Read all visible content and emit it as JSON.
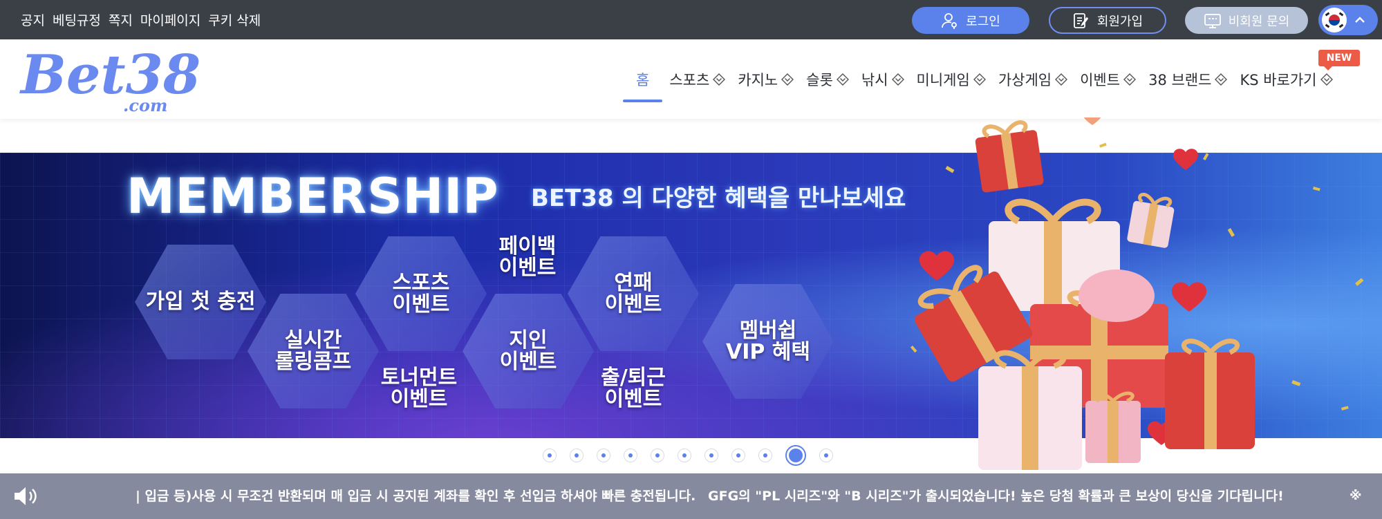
{
  "topbar": {
    "links": [
      "공지",
      "베팅규정",
      "쪽지",
      "마이페이지",
      "쿠키 삭제"
    ],
    "login_label": "로그인",
    "join_label": "회원가입",
    "inquiry_label": "비회원 문의",
    "language_flag": "korea-flag-icon"
  },
  "header": {
    "logo_text": "Bet38",
    "logo_sub": ".com",
    "nav": [
      {
        "label": "홈",
        "active": true
      },
      {
        "label": "스포츠"
      },
      {
        "label": "카지노"
      },
      {
        "label": "슬롯"
      },
      {
        "label": "낚시"
      },
      {
        "label": "미니게임"
      },
      {
        "label": "가상게임"
      },
      {
        "label": "이벤트"
      },
      {
        "label": "38 브랜드"
      },
      {
        "label": "KS 바로가기"
      }
    ],
    "new_badge": "NEW"
  },
  "banner": {
    "title": "MEMBERSHIP",
    "subtitle": "BET38 의 다양한 혜택을 만나보세요",
    "hexes": [
      "가입 첫 충전",
      "실시간\n롤링콤프",
      "스포츠\n이벤트",
      "토너먼트\n이벤트",
      "페이백\n이벤트",
      "지인\n이벤트",
      "연패\n이벤트",
      "출/퇴근\n이벤트",
      "멤버쉽\nVIP 혜택"
    ],
    "slide_count": 11,
    "active_slide": 10
  },
  "ticker": {
    "message_1": "| 입금 등)사용 시 무조건 반환되며 매 입금 시 공지된 계좌를 확인 후 선입금 하셔야 빠른 충전됩니다.",
    "message_2": "GFG의 \"PL 시리즈\"와 \"B 시리즈\"가 출시되었습니다! 높은 당첨 확률과 큰 보상이 당신을 기다립니다!",
    "message_3": "※"
  },
  "colors": {
    "topbar_bg": "#3b4047",
    "accent": "#5b82ea",
    "ticker_bg": "#858a9e",
    "new_badge": "#ec5b45"
  }
}
